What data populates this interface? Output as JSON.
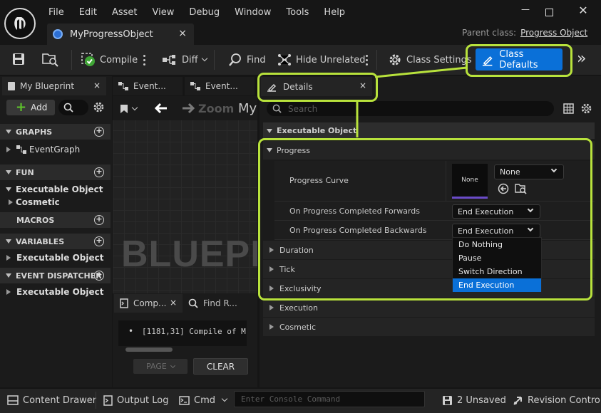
{
  "menu": [
    "File",
    "Edit",
    "Asset",
    "View",
    "Debug",
    "Window",
    "Tools",
    "Help"
  ],
  "asset_tab": {
    "label": "MyProgressObject",
    "close": "×"
  },
  "parent_class": {
    "prefix": "Parent class:",
    "value": "Progress Object"
  },
  "window_controls": {
    "minimize": "—",
    "maximize": "☐",
    "close": "✕"
  },
  "toolbar": {
    "compile": "Compile",
    "diff": "Diff",
    "find": "Find",
    "hide_unrelated": "Hide Unrelated",
    "class_settings": "Class Settings",
    "class_defaults": "Class Defaults",
    "overflow": "»"
  },
  "my_blueprint": {
    "tab_label": "My Blueprint",
    "close": "×",
    "add_label": "Add",
    "sections": {
      "graphs": "GRAPHS",
      "functions": "FUN",
      "macros": "MACROS",
      "variables": "VARIABLES",
      "dispatchers": "EVENT DISPATCHERS"
    },
    "items": {
      "event_graph": "EventGraph",
      "fn_category": "Executable Object",
      "fn_sub": "Cosmetic",
      "var_category": "Executable Object",
      "disp_category": "Executable Object"
    }
  },
  "graph_tabs": [
    {
      "label": "Event..."
    },
    {
      "label": "Event..."
    }
  ],
  "graph": {
    "zoom": "Zoom",
    "title": "My",
    "watermark": "BLUEPRI"
  },
  "bottom_tabs": {
    "compiler": "Comp...",
    "find": "Find R...",
    "close": "×"
  },
  "compiler_log": {
    "entry": "[1181,31] Compile of M",
    "page_label": "PAGE",
    "clear_label": "CLEAR"
  },
  "details": {
    "tab_label": "Details",
    "close": "×",
    "search_placeholder": "Search",
    "category": "Executable Object",
    "progress_group": "Progress",
    "progress_curve": {
      "label": "Progress Curve",
      "thumb": "None",
      "value": "None"
    },
    "forwards": {
      "label": "On Progress Completed Forwards",
      "value": "End Execution"
    },
    "backwards": {
      "label": "On Progress Completed Backwards",
      "value": "End Execution"
    },
    "collapsed": [
      "Duration",
      "Tick",
      "Exclusivity",
      "Execution",
      "Cosmetic"
    ],
    "dropdown_options": [
      "Do Nothing",
      "Pause",
      "Switch Direction",
      "End Execution"
    ],
    "selected_option": "End Execution"
  },
  "status_bar": {
    "content_drawer": "Content Drawer",
    "output_log": "Output Log",
    "cmd": "Cmd",
    "console_placeholder": "Enter Console Command",
    "unsaved": "2 Unsaved",
    "revision": "Revision Control_"
  },
  "colors": {
    "accent": "#0a70d8",
    "highlight": "#b8e23c",
    "selected_option": "#0a70d8"
  }
}
